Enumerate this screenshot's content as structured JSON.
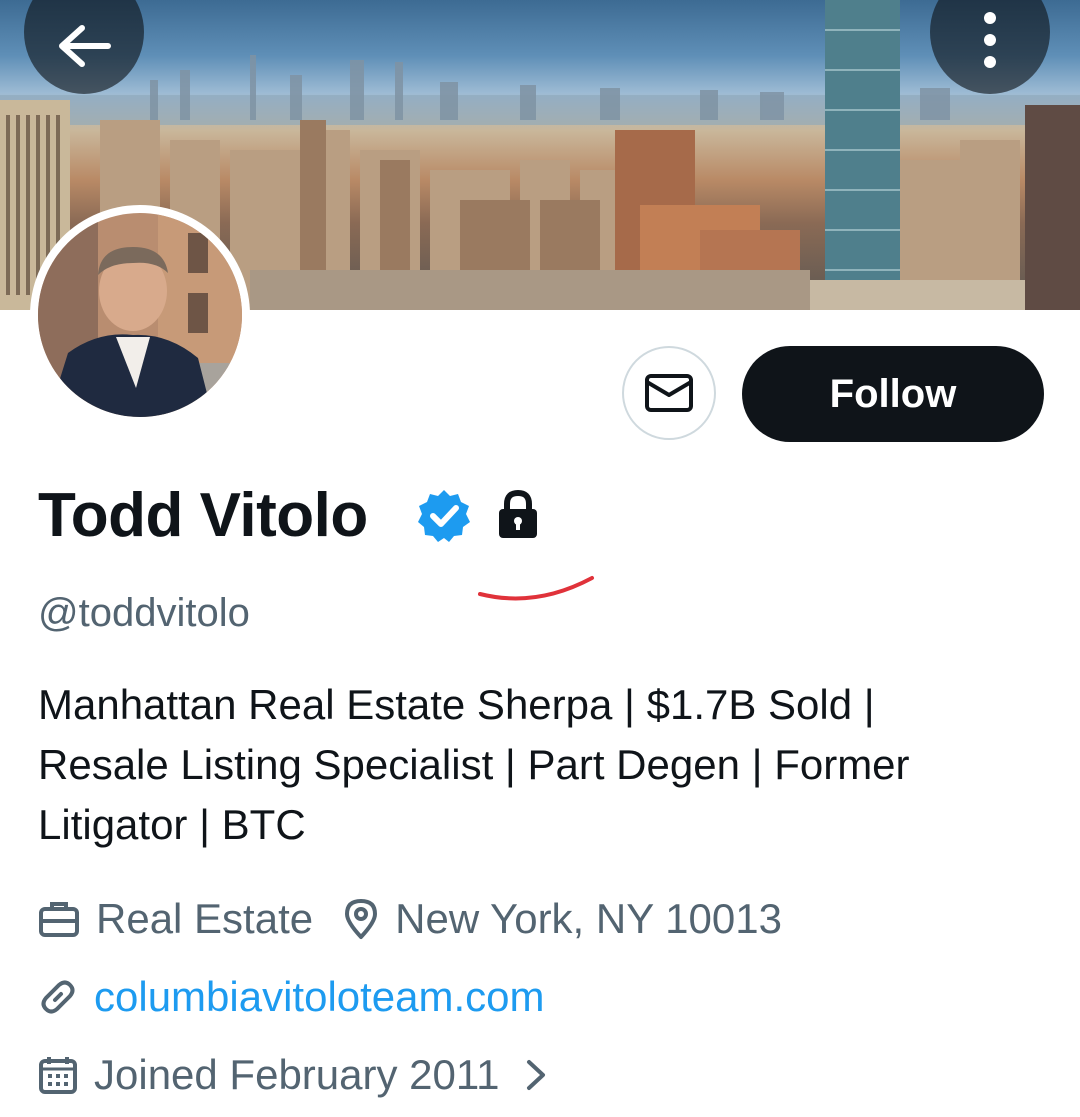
{
  "header": {
    "back_icon": "arrow-left-icon",
    "more_icon": "more-vertical-icon"
  },
  "profile": {
    "display_name": "Todd Vitolo",
    "handle": "@toddvitolo",
    "verified_icon": "verified-badge-icon",
    "protected_icon": "lock-icon",
    "bio_lines": [
      "Manhattan Real Estate Sherpa | $1.7B Sold |",
      "Resale Listing Specialist | Part Degen | Former",
      "Litigator | BTC"
    ],
    "category": "Real Estate",
    "location": "New York, NY 10013",
    "website": "columbiavitoloteam.com",
    "joined": "Joined February 2011"
  },
  "actions": {
    "message_icon": "envelope-icon",
    "follow_label": "Follow"
  },
  "colors": {
    "primary_text": "#0f1419",
    "secondary_text": "#536471",
    "link": "#1d9bf0",
    "verified": "#1d9bf0",
    "annotation": "#e0323a"
  }
}
